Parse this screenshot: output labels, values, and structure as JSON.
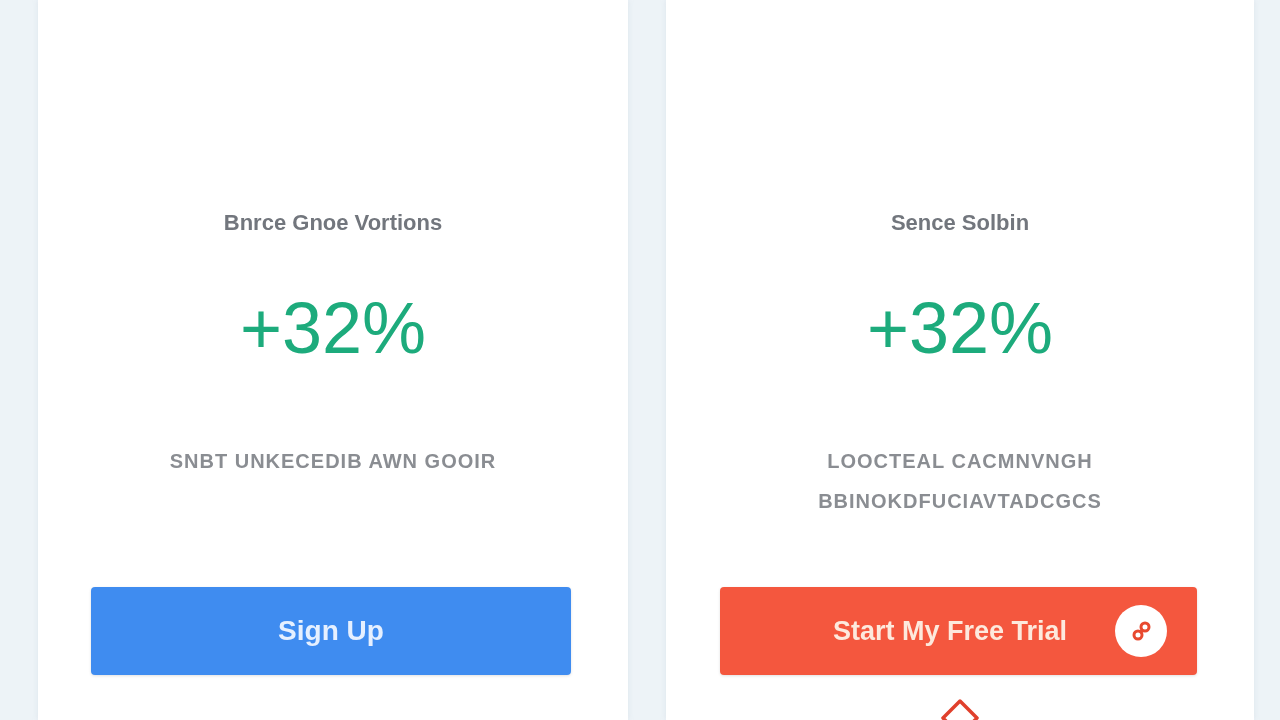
{
  "cards": [
    {
      "title": "Bnrce Gnoe Vortions",
      "value": "+32%",
      "caption": [
        "SNBT UNKECEDIB AWN GOOIR"
      ],
      "button": {
        "label": "Sign Up",
        "kind": "primary"
      }
    },
    {
      "title": "Sence Solbin",
      "value": "+32%",
      "caption": [
        "LOOCTEAL CACMNVNGH",
        "BBINOKDFUCIAVTADCGCS"
      ],
      "button": {
        "label": "Start My Free Trial",
        "kind": "trial"
      }
    }
  ]
}
